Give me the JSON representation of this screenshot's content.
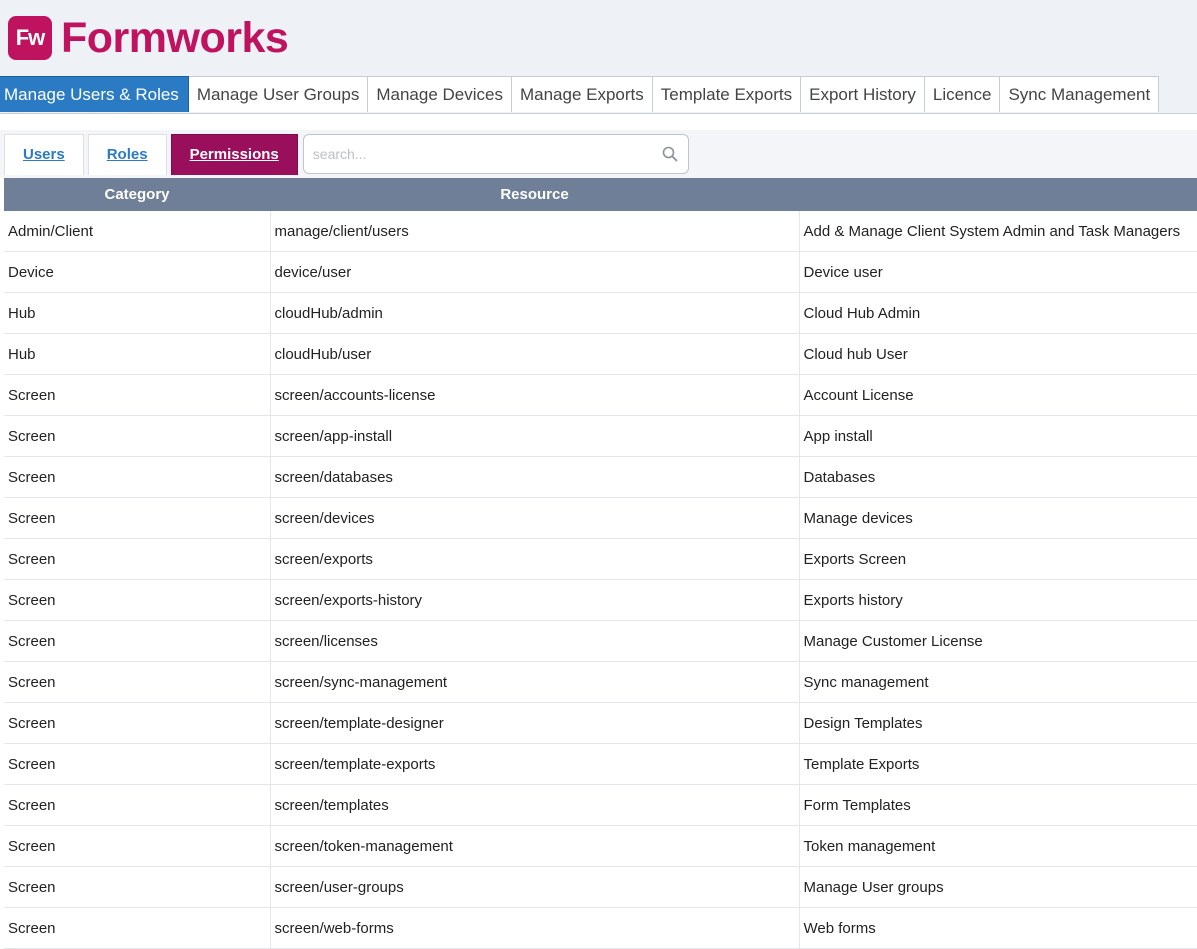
{
  "brand": {
    "badge": "Fw",
    "name": "Formworks"
  },
  "top_tabs": [
    {
      "label": "Manage Users & Roles",
      "active": true
    },
    {
      "label": "Manage User Groups"
    },
    {
      "label": "Manage Devices"
    },
    {
      "label": "Manage Exports"
    },
    {
      "label": "Template Exports"
    },
    {
      "label": "Export History"
    },
    {
      "label": "Licence"
    },
    {
      "label": "Sync Management"
    }
  ],
  "sub_tabs": [
    {
      "label": "Users"
    },
    {
      "label": "Roles"
    },
    {
      "label": "Permissions",
      "active": true
    }
  ],
  "search": {
    "placeholder": "search...",
    "value": "",
    "icon": "search-icon"
  },
  "table": {
    "headers": [
      "Category",
      "Resource",
      ""
    ],
    "rows": [
      [
        "Admin/Client",
        "manage/client/users",
        "Add & Manage Client System Admin and Task Managers"
      ],
      [
        "Device",
        "device/user",
        "Device user"
      ],
      [
        "Hub",
        "cloudHub/admin",
        "Cloud Hub Admin"
      ],
      [
        "Hub",
        "cloudHub/user",
        "Cloud hub User"
      ],
      [
        "Screen",
        "screen/accounts-license",
        "Account License"
      ],
      [
        "Screen",
        "screen/app-install",
        "App install"
      ],
      [
        "Screen",
        "screen/databases",
        "Databases"
      ],
      [
        "Screen",
        "screen/devices",
        "Manage devices"
      ],
      [
        "Screen",
        "screen/exports",
        "Exports Screen"
      ],
      [
        "Screen",
        "screen/exports-history",
        "Exports history"
      ],
      [
        "Screen",
        "screen/licenses",
        "Manage Customer License"
      ],
      [
        "Screen",
        "screen/sync-management",
        "Sync management"
      ],
      [
        "Screen",
        "screen/template-designer",
        "Design Templates"
      ],
      [
        "Screen",
        "screen/template-exports",
        "Template Exports"
      ],
      [
        "Screen",
        "screen/templates",
        "Form Templates"
      ],
      [
        "Screen",
        "screen/token-management",
        "Token management"
      ],
      [
        "Screen",
        "screen/user-groups",
        "Manage User groups"
      ],
      [
        "Screen",
        "screen/web-forms",
        "Web forms"
      ]
    ]
  },
  "colors": {
    "brand": "#c0135f",
    "active_tab": "#2a7bc4",
    "active_subtab": "#9a0f5c",
    "table_header": "#6f7f98"
  }
}
